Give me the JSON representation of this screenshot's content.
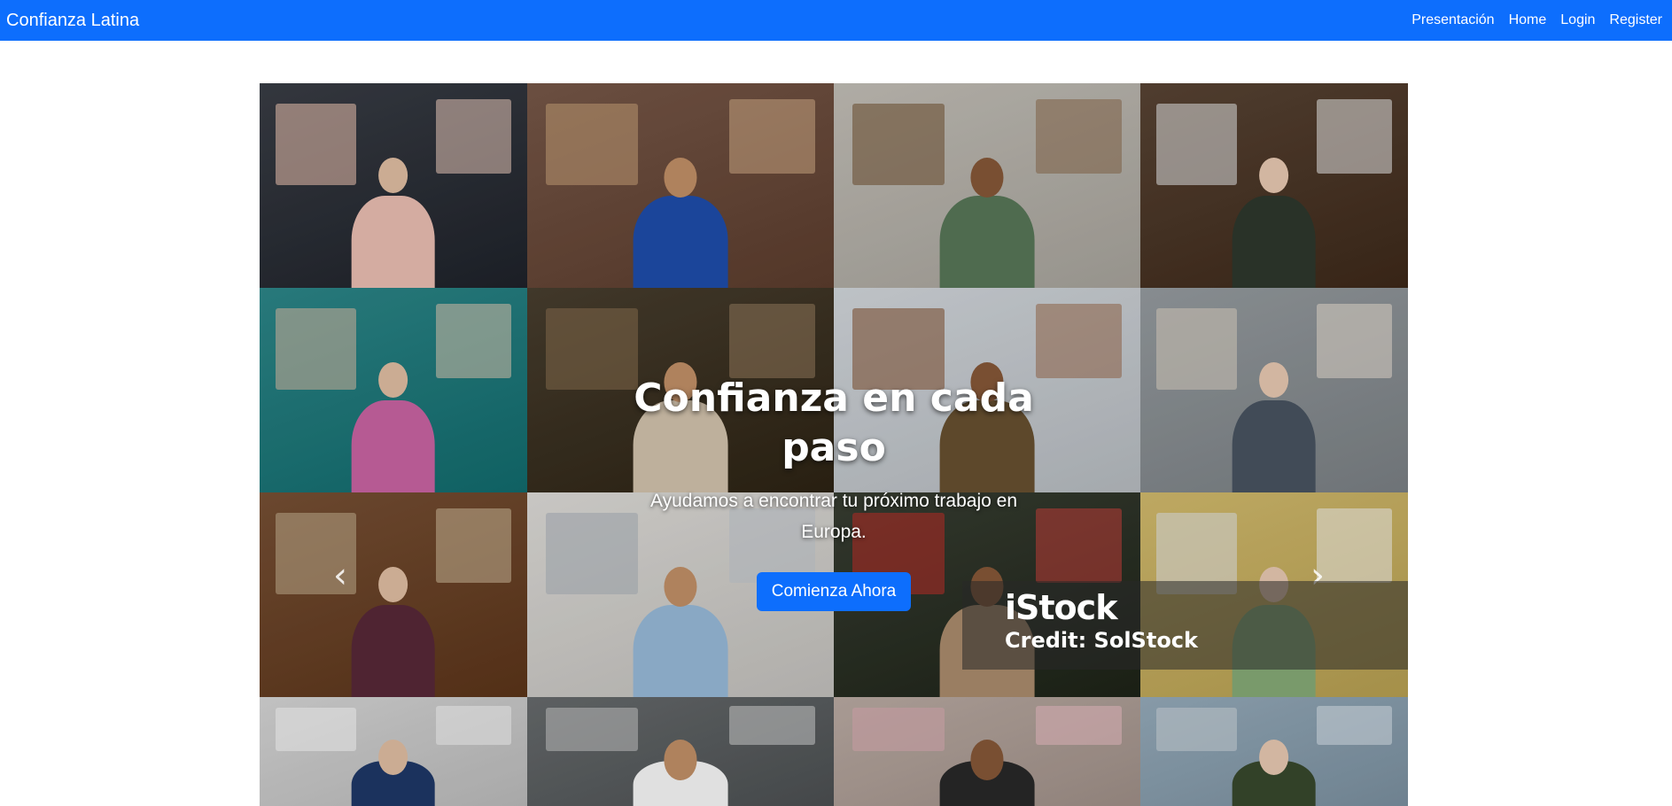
{
  "navbar": {
    "brand": "Confianza Latina",
    "links": [
      "Presentación",
      "Home",
      "Login",
      "Register"
    ],
    "background": "#0d6efd"
  },
  "hero": {
    "title": "Confianza en cada paso",
    "subtitle": "Ayudamos a encontrar tu próximo trabajo en Europa.",
    "cta_label": "Comienza Ahora",
    "prev_icon": "chevron-left-icon",
    "next_icon": "chevron-right-icon"
  },
  "watermark": {
    "logo": "iStock",
    "credit": "Credit: SolStock"
  },
  "tiles": [
    {
      "bg": "#3b3f47",
      "accent": "#f3c9b8",
      "shirt": "#f2c4b8"
    },
    {
      "bg": "#7a5a4a",
      "accent": "#c9a27a",
      "shirt": "#1f4fb0"
    },
    {
      "bg": "#c8c4bc",
      "accent": "#7a5a3a",
      "shirt": "#5a7a5a"
    },
    {
      "bg": "#5b4636",
      "accent": "#e6e6e6",
      "shirt": "#2f3a2e"
    },
    {
      "bg": "#2e8a8c",
      "accent": "#d9c0a8",
      "shirt": "#d067a8"
    },
    {
      "bg": "#4a4030",
      "accent": "#8a7050",
      "shirt": "#d9c9b2"
    },
    {
      "bg": "#d8dde2",
      "accent": "#8a5a3a",
      "shirt": "#6a5232"
    },
    {
      "bg": "#9aa0a4",
      "accent": "#e0d6c8",
      "shirt": "#4a5664"
    },
    {
      "bg": "#7a5236",
      "accent": "#c4b090",
      "shirt": "#5a2a3a"
    },
    {
      "bg": "#e4e2de",
      "accent": "#b0b8c0",
      "shirt": "#9cc0e0"
    },
    {
      "bg": "#3a4034",
      "accent": "#c0302a",
      "shirt": "#b09070"
    },
    {
      "bg": "#d8c070",
      "accent": "#e8e8e8",
      "shirt": "#8ab07a"
    },
    {
      "bg": "#dcdcdc",
      "accent": "#ffffff",
      "shirt": "#1f3a6a"
    },
    {
      "bg": "#6a6e70",
      "accent": "#c8c8c8",
      "shirt": "#ffffff"
    },
    {
      "bg": "#c0b0a8",
      "accent": "#e0b0b8",
      "shirt": "#2a2a2a"
    },
    {
      "bg": "#9ab0c0",
      "accent": "#d0d8e0",
      "shirt": "#3a4a2e"
    }
  ]
}
